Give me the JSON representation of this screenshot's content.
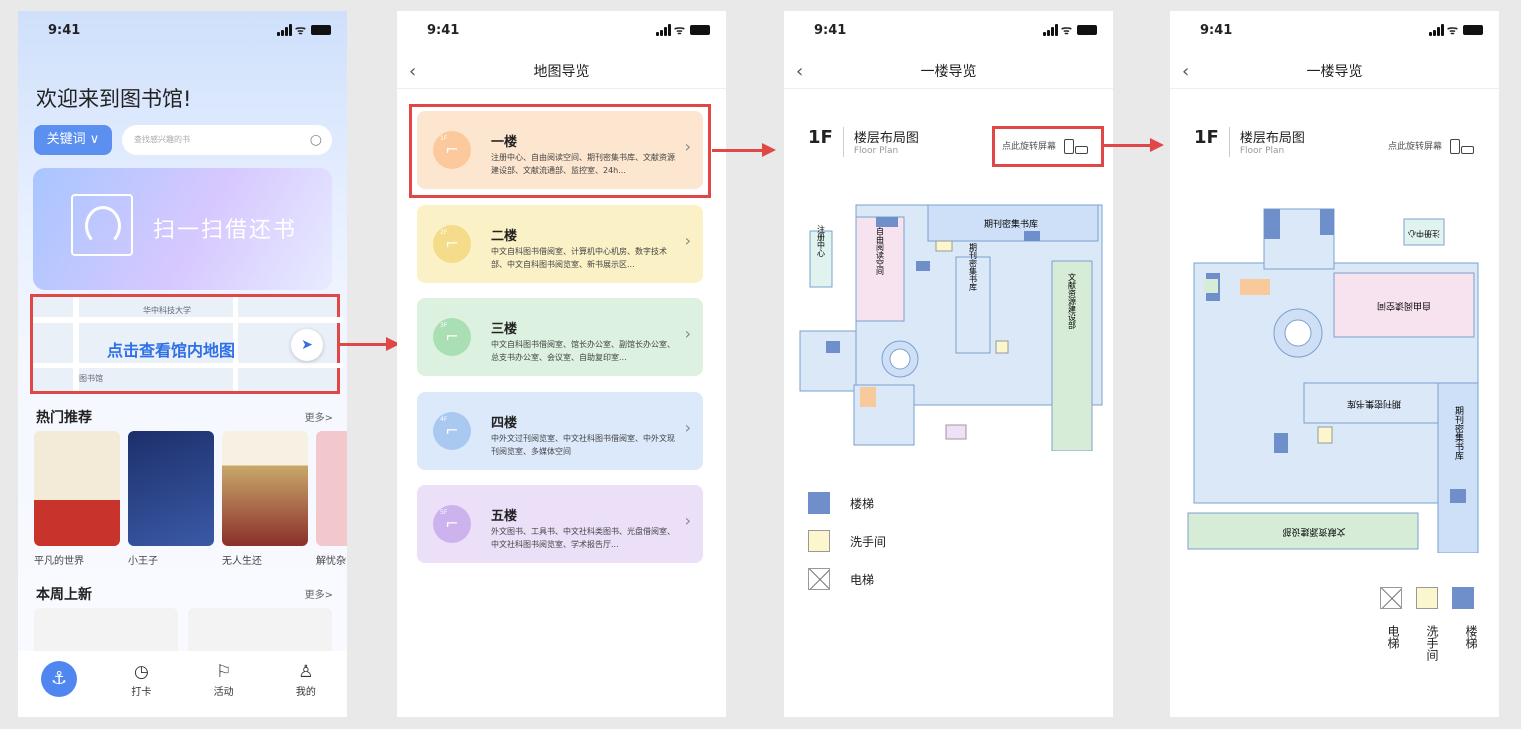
{
  "status_time": "9:41",
  "home": {
    "welcome": "欢迎来到图书馆!",
    "keyword_label": "关键词 ∨",
    "search_placeholder": "查找感兴趣的书",
    "scan_label": "扫一扫借还书",
    "map_label": "点击查看馆内地图",
    "map_place_1": "华中科技大学",
    "map_place_2": "图书馆",
    "hot_title": "热门推荐",
    "hot_more": "更多>",
    "books": [
      "平凡的世界",
      "小王子",
      "无人生还",
      "解忧杂"
    ],
    "new_title": "本周上新",
    "new_more": "更多>",
    "tabs": [
      "打卡",
      "活动",
      "我的"
    ]
  },
  "map_list": {
    "title": "地图导览",
    "floors": [
      {
        "badge": "1F",
        "name": "一楼",
        "desc": "注册中心、自由阅读空间、期刊密集书库、文献资源建设部、文献流通部、监控室、24h..."
      },
      {
        "badge": "2F",
        "name": "二楼",
        "desc": "中文自科图书借阅室、计算机中心机房、数字技术部、中文自科图书阅览室、新书展示区..."
      },
      {
        "badge": "3F",
        "name": "三楼",
        "desc": "中文自科图书借阅室、馆长办公室、副馆长办公室、总支书办公室、会议室、自助复印室..."
      },
      {
        "badge": "4F",
        "name": "四楼",
        "desc": "中外文过刊阅览室、中文社科图书借阅室、中外文现刊阅览室、多媒体空间"
      },
      {
        "badge": "5F",
        "name": "五楼",
        "desc": "外文图书、工具书、中文社科类图书、光盘借阅室、中文社科图书阅览室、学术报告厅..."
      }
    ],
    "colors": [
      "#fde6cf",
      "#fbf1c7",
      "#dcf1df",
      "#dbe9fb",
      "#ece0f8"
    ],
    "circle_colors": [
      "#fbc99b",
      "#f5dc8a",
      "#a9dfb3",
      "#a9c9f1",
      "#cdb3ee"
    ]
  },
  "floor_view": {
    "title": "一楼导览",
    "floor": "1F",
    "plan_title": "楼层布局图",
    "plan_subtitle": "Floor Plan",
    "rotate": "点此旋转屏幕",
    "rooms": {
      "stacks": "期刊密集书库",
      "reading": "自由阅读空间",
      "register": "注册中心",
      "journals": "期刊密集书库",
      "acquisition": "文献资源建设部"
    },
    "legend": [
      "楼梯",
      "洗手间",
      "电梯"
    ]
  }
}
